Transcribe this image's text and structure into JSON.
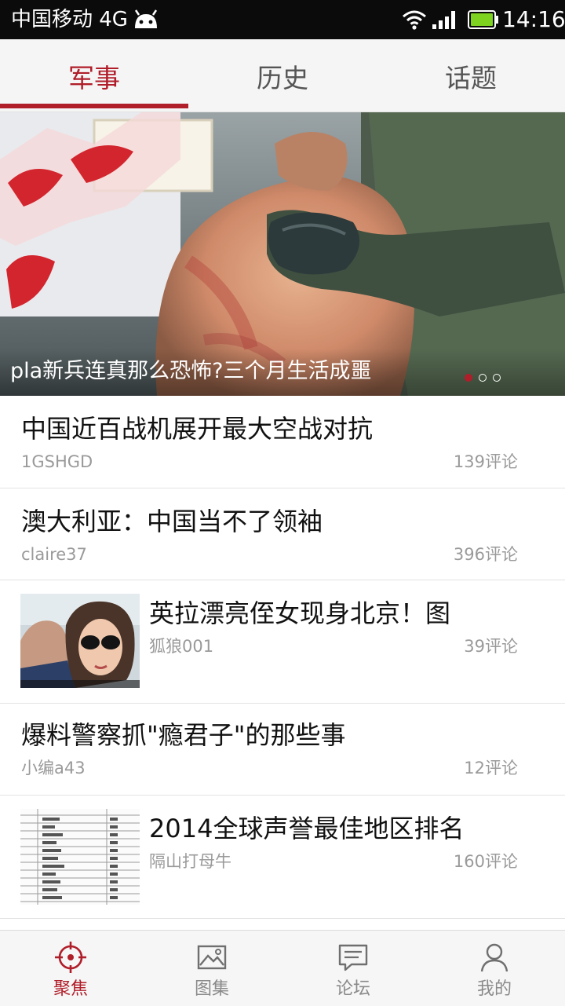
{
  "status_bar": {
    "carrier": "中国移动 4G",
    "time": "14:16",
    "icons": [
      "android-icon",
      "wifi-icon",
      "signal-icon",
      "battery-icon"
    ]
  },
  "tabs": [
    {
      "label": "军事",
      "active": true
    },
    {
      "label": "历史",
      "active": false
    },
    {
      "label": "话题",
      "active": false
    }
  ],
  "banner": {
    "title": "pla新兵连真那么恐怖?三个月生活成噩",
    "page_count": 3,
    "active_page": 1
  },
  "articles": [
    {
      "title": "中国近百战机展开最大空战对抗",
      "author": "1GSHGD",
      "comments": "139评论",
      "thumbnail": false
    },
    {
      "title": "澳大利亚：中国当不了领袖",
      "author": "claire37",
      "comments": "396评论",
      "thumbnail": false
    },
    {
      "title": "英拉漂亮侄女现身北京！图",
      "author": "狐狼001",
      "comments": "39评论",
      "thumbnail": true
    },
    {
      "title": "爆料警察抓\"瘾君子\"的那些事",
      "author": "小编a43",
      "comments": "12评论",
      "thumbnail": false
    },
    {
      "title": "2014全球声誉最佳地区排名",
      "author": "隔山打母牛",
      "comments": "160评论",
      "thumbnail": true
    }
  ],
  "bottom_nav": [
    {
      "label": "聚焦",
      "icon": "crosshair-icon",
      "active": true
    },
    {
      "label": "图集",
      "icon": "image-icon",
      "active": false
    },
    {
      "label": "论坛",
      "icon": "chat-icon",
      "active": false
    },
    {
      "label": "我的",
      "icon": "user-icon",
      "active": false
    }
  ],
  "colors": {
    "accent": "#b01e2a",
    "status_bar": "#0b0b0b",
    "battery": "#7ed321"
  }
}
